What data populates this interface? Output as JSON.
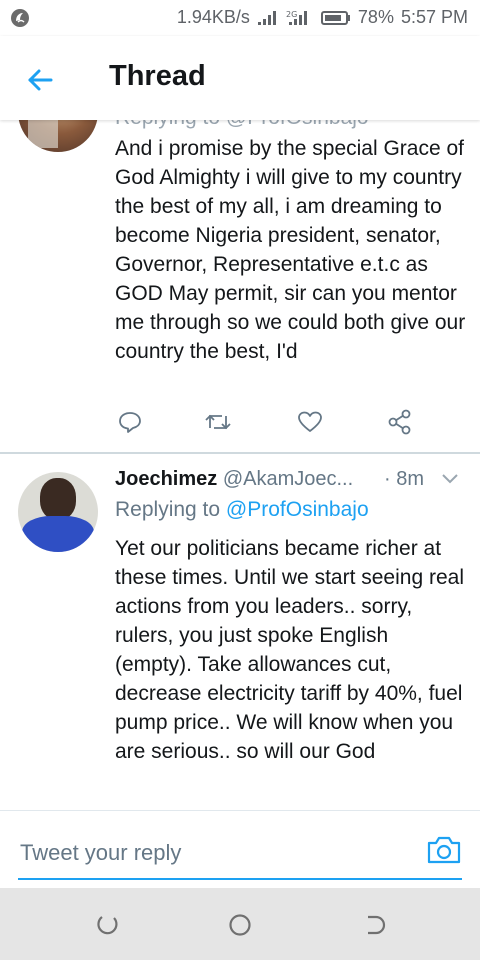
{
  "status_bar": {
    "speed": "1.94KB/s",
    "battery": "78%",
    "time": "5:57 PM"
  },
  "header": {
    "title": "Thread"
  },
  "tweets": [
    {
      "partial_top_line": "Replying to @ProfOsinbajo",
      "text": "And i promise by the special Grace of God Almighty i will give to my country the best of my all, i am dreaming to become Nigeria president, senator, Governor, Representative e.t.c as GOD May permit, sir can you mentor me through so we could both give our country the best, I'd"
    },
    {
      "name": "Joechimez",
      "handle": "@AkamJoec...",
      "time": "· 8m",
      "replying_prefix": "Replying to",
      "replying_to": "@ProfOsinbajo",
      "text": "Yet our politicians became richer at these times. Until we start seeing real actions from you leaders.. sorry, rulers, you just spoke English (empty). Take allowances cut, decrease electricity tariff by 40%, fuel pump price.. We will know when you are serious.. so will our God"
    }
  ],
  "composer": {
    "placeholder": "Tweet your reply"
  },
  "colors": {
    "accent": "#1da1f2",
    "secondary_text": "#657786",
    "nav_bar": "#e5e5e5"
  },
  "icons": {
    "reply": "speech-bubble",
    "retweet": "retweet-arrows",
    "like": "heart",
    "share": "share-nodes",
    "camera": "camera",
    "back": "arrow-left"
  }
}
